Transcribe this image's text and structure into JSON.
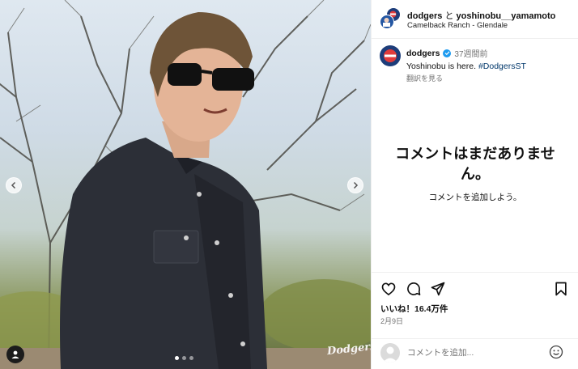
{
  "post": {
    "carousel": {
      "slide_count": 3,
      "active_slide": 1,
      "prev_icon": "chevron-left-icon",
      "next_icon": "chevron-right-icon",
      "watermark": "Dodgers"
    },
    "header": {
      "user1": "dodgers",
      "conjunction": " と ",
      "user2": "yoshinobu__yamamoto",
      "location": "Camelback Ranch - Glendale"
    },
    "caption": {
      "username": "dodgers",
      "verified_icon": "verified-badge-icon",
      "time": "37週間前",
      "text": "Yoshinobu is here. ",
      "hashtag": "#DodgersST",
      "translate": "翻訳を見る"
    },
    "comments": {
      "empty_title": "コメントはまだありません。",
      "empty_subtitle": "コメントを追加しよう。"
    },
    "actions": {
      "icons": [
        "heart-icon",
        "comment-icon",
        "share-icon",
        "bookmark-icon"
      ],
      "likes": "いいね！16.4万件",
      "date": "2月9日"
    },
    "comment_box": {
      "placeholder": "コメントを追加...",
      "emoji_icon": "emoji-icon"
    },
    "colors": {
      "link": "#00376b",
      "verified": "#1d9bf0",
      "muted": "#737373",
      "brand_blue": "#1d3d7a"
    }
  }
}
